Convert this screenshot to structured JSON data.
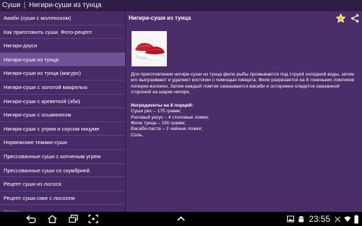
{
  "header": {
    "app_name": "Суши",
    "separator": "|",
    "page_title": "Нигири-суши из тунца"
  },
  "sidebar": {
    "items": [
      {
        "label": "Аваби (суши с моллюском)"
      },
      {
        "label": "Как приготовить суши. Фото-рецепт"
      },
      {
        "label": "Нигири-дзуси"
      },
      {
        "label": "Нигири-суши из тунца",
        "selected": true
      },
      {
        "label": "Нигири-суши из тунца (магуро)"
      },
      {
        "label": "Нигири-суши с золотой макрелью"
      },
      {
        "label": "Нигири-суши с креветкой (эби)"
      },
      {
        "label": "Нигири-суши с осьминогом"
      },
      {
        "label": "Нигири-суши с угрем и соусом ницуме"
      },
      {
        "label": "Норвежские темаки-суши"
      },
      {
        "label": "Прессованные суши с копченым угрем"
      },
      {
        "label": "Прессованные суши со скумбрией"
      },
      {
        "label": "Рецепт суши из лосося"
      },
      {
        "label": "Рецепт суши сяке с лососем"
      },
      {
        "label": "Роллы"
      }
    ]
  },
  "content": {
    "title": "Нигири-суши из тунца",
    "description": "Для приготовления нигири-суши из тунца филе рыбы промывается под струей холодной воды, затем его высушивают и удаляют косточки с помощью пинцета. Филе разрезается на 8 тоненьких ломтиков поперек волокон. Затем каждый ломтик смазывается васаби и осторожно кладется смазанной стороной на шарик нигири.",
    "ingredients_title": "Ингредиенты на 8 порций:",
    "ingredients": [
      "Суши рис – 175 грамм;",
      "Рисовый уксус – 4 столовые ложки;",
      "Филе тунца – 150 грамм;",
      "Васаби-паста – 2 чайные ложки;",
      "Соль."
    ]
  },
  "statusbar": {
    "time": "23:55"
  },
  "icons": {
    "favorite": "star-icon",
    "share": "share-icon",
    "back": "back-icon",
    "home": "home-icon",
    "recent": "recent-apps-icon",
    "screenshot": "screenshot-icon",
    "menu": "menu-icon"
  },
  "colors": {
    "background": "#4b2d6a",
    "title_bar": "#2f1d45",
    "selected_item": "#6e5296",
    "star": "#f7c600"
  }
}
